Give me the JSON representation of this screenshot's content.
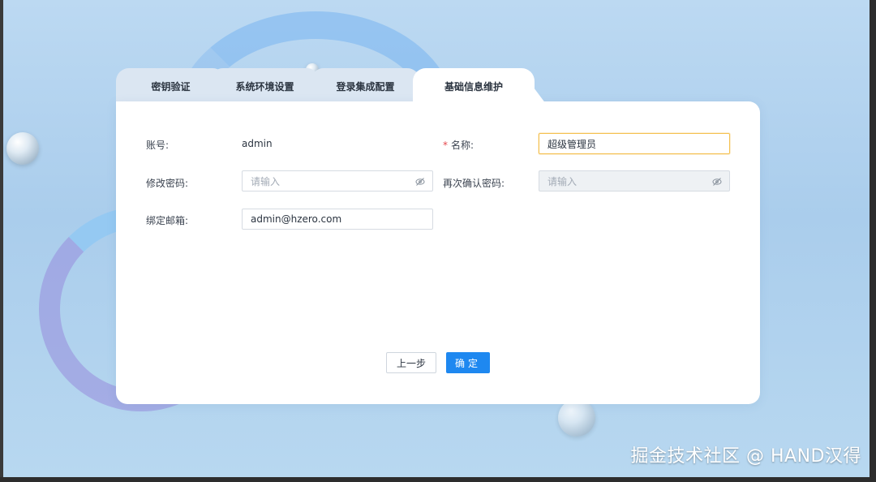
{
  "tabs": [
    {
      "label": "密钥验证",
      "active": false
    },
    {
      "label": "系统环境设置",
      "active": false
    },
    {
      "label": "登录集成配置",
      "active": false
    },
    {
      "label": "基础信息维护",
      "active": true
    }
  ],
  "form": {
    "account_label": "账号:",
    "account_value": "admin",
    "name_required_mark": "*",
    "name_label": "名称:",
    "name_value": "超级管理员",
    "password_label": "修改密码:",
    "password_placeholder": "请输入",
    "confirm_label": "再次确认密码:",
    "confirm_placeholder": "请输入",
    "email_label": "绑定邮箱:",
    "email_value": "admin@hzero.com"
  },
  "actions": {
    "prev_label": "上一步",
    "ok_label": "确定"
  },
  "watermark": "掘金技术社区 @ HAND汉得",
  "colors": {
    "primary": "#1e88f0",
    "focus_border": "#f4c04f",
    "required": "#e5484d"
  }
}
